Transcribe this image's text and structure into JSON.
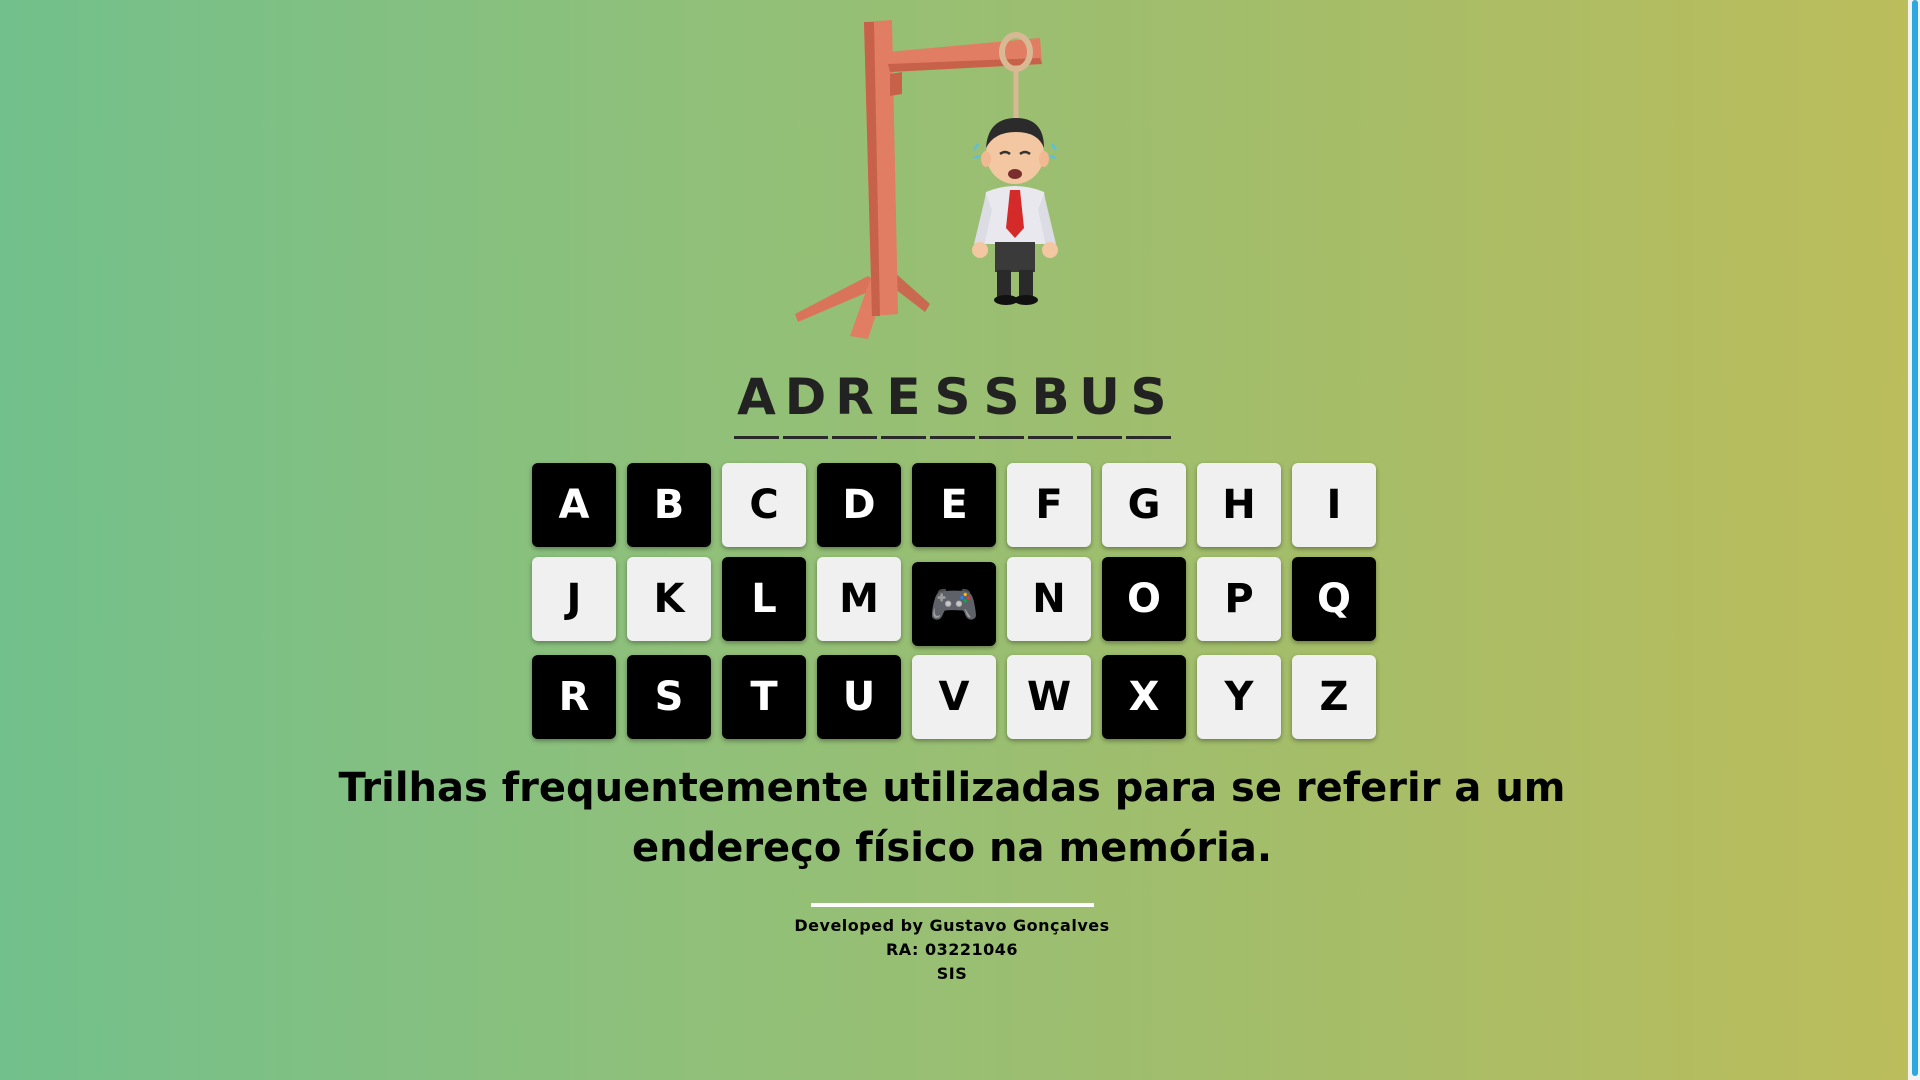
{
  "colors": {
    "background_left": "#72c08c",
    "background_right": "#bcbd5b",
    "key_used": "#000000",
    "key_free": "#f0f0f0",
    "scrollbar_thumb": "#2aa8df"
  },
  "hangman_image": {
    "icon": "gallows-with-hanged-man-icon"
  },
  "word": [
    "A",
    "D",
    "R",
    "E",
    "S",
    "S",
    "B",
    "U",
    "S"
  ],
  "keyboard": {
    "row1": [
      {
        "label": "A",
        "used": true
      },
      {
        "label": "B",
        "used": true
      },
      {
        "label": "C",
        "used": false
      },
      {
        "label": "D",
        "used": true
      },
      {
        "label": "E",
        "used": true
      },
      {
        "label": "F",
        "used": false
      },
      {
        "label": "G",
        "used": false
      },
      {
        "label": "H",
        "used": false
      },
      {
        "label": "I",
        "used": false
      }
    ],
    "row2": [
      {
        "label": "J",
        "used": false
      },
      {
        "label": "K",
        "used": false
      },
      {
        "label": "L",
        "used": true
      },
      {
        "label": "M",
        "used": false
      },
      {
        "label": "🎮",
        "used": true,
        "icon": "game-controller-icon"
      },
      {
        "label": "N",
        "used": false
      },
      {
        "label": "O",
        "used": true
      },
      {
        "label": "P",
        "used": false
      },
      {
        "label": "Q",
        "used": true
      }
    ],
    "row3": [
      {
        "label": "R",
        "used": true
      },
      {
        "label": "S",
        "used": true
      },
      {
        "label": "T",
        "used": true
      },
      {
        "label": "U",
        "used": true
      },
      {
        "label": "V",
        "used": false
      },
      {
        "label": "W",
        "used": false
      },
      {
        "label": "X",
        "used": true
      },
      {
        "label": "Y",
        "used": false
      },
      {
        "label": "Z",
        "used": false
      }
    ]
  },
  "hint": "Trilhas frequentemente utilizadas para se referir a um endereço físico na memória.",
  "footer": {
    "developer": "Developed by Gustavo Gonçalves",
    "ra": "RA: 03221046",
    "course": "SIS"
  }
}
